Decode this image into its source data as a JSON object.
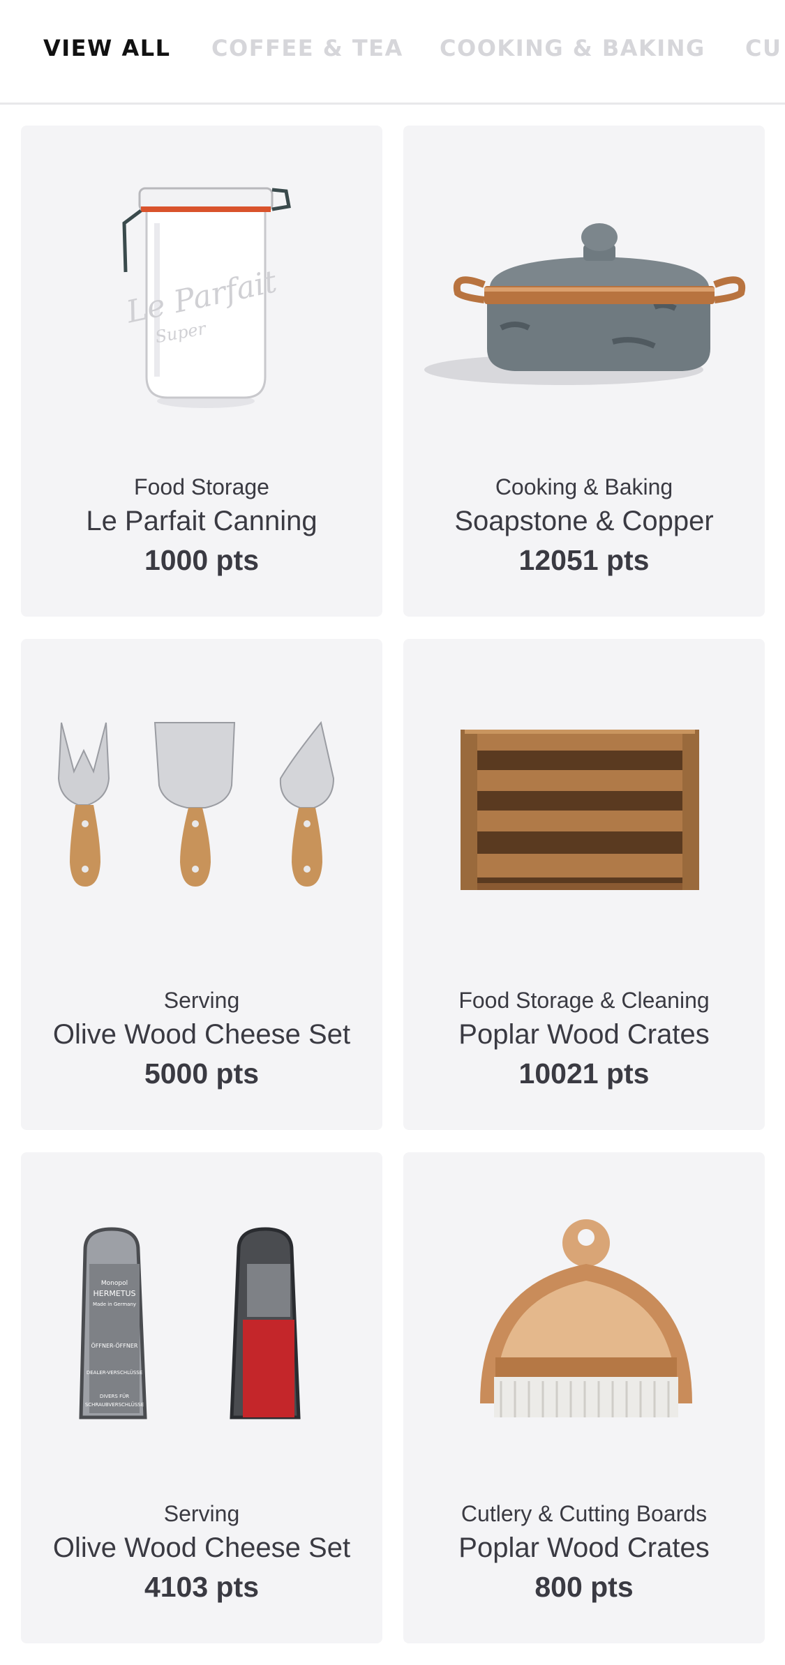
{
  "tabs": [
    {
      "label": "VIEW ALL",
      "active": true
    },
    {
      "label": "COFFEE & TEA",
      "active": false
    },
    {
      "label": "COOKING & BAKING",
      "active": false
    },
    {
      "label": "CU",
      "active": false
    }
  ],
  "products": [
    {
      "category": "Food Storage",
      "name": "Le Parfait Canning",
      "points": "1000 pts",
      "icon": "glass-jar-image",
      "jar_text": "Le Parfait",
      "jar_subtext": "Super"
    },
    {
      "category": "Cooking & Baking",
      "name": "Soapstone & Copper",
      "points": "12051 pts",
      "icon": "soapstone-pot-image"
    },
    {
      "category": "Serving",
      "name": "Olive Wood Cheese Set",
      "points": "5000 pts",
      "icon": "cheese-knives-image"
    },
    {
      "category": "Food Storage & Cleaning",
      "name": "Poplar Wood Crates",
      "points": "10021 pts",
      "icon": "wood-crate-image"
    },
    {
      "category": "Serving",
      "name": "Olive Wood Cheese Set",
      "points": "4103 pts",
      "icon": "bottle-openers-image",
      "opener_text": [
        "Monopol",
        "HERMETUS",
        "Made in Germany",
        "ÖFFNER-ÖFFNER",
        "DEALER-VERSCHLÜSSE",
        "DIVERS FÜR",
        "SCHRAUBVERSCHLÜSSE"
      ]
    },
    {
      "category": "Cutlery & Cutting Boards",
      "name": "Poplar Wood Crates",
      "points": "800 pts",
      "icon": "dustpan-brush-image"
    }
  ],
  "colors": {
    "card_bg": "#f4f4f6",
    "text": "#3a3a42",
    "tab_active": "#111111",
    "tab_inactive": "#d6d6da"
  }
}
